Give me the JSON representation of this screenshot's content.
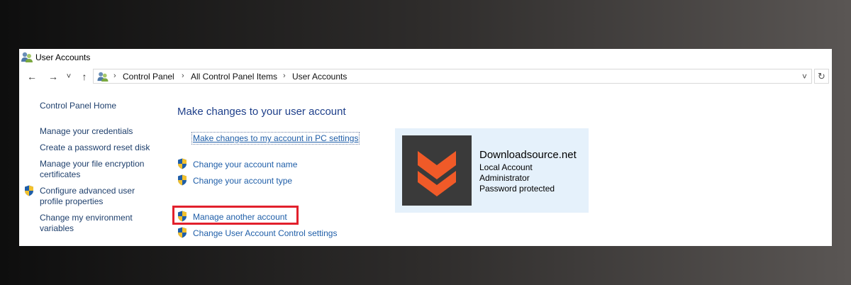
{
  "window": {
    "title": "User Accounts"
  },
  "nav": {
    "back_glyph": "←",
    "forward_glyph": "→",
    "recent_glyph": "˅",
    "up_glyph": "↑",
    "dropdown_glyph": "˅",
    "refresh_glyph": "↻"
  },
  "address": {
    "separator": "›",
    "crumbs": [
      "Control Panel",
      "All Control Panel Items",
      "User Accounts"
    ]
  },
  "sidebar": {
    "home": "Control Panel Home",
    "credentials": "Manage your credentials",
    "reset_disk": "Create a password reset disk",
    "encryption_1": "Manage your file encryption",
    "encryption_2": "certificates",
    "advanced_1": "Configure advanced user",
    "advanced_2": "profile properties",
    "environment_1": "Change my environment",
    "environment_2": "variables"
  },
  "main": {
    "heading": "Make changes to your user account",
    "pc_settings": "Make changes to my account in PC settings",
    "change_name": "Change your account name",
    "change_type": "Change your account type",
    "manage_other": "Manage another account",
    "uac_settings": "Change User Account Control settings"
  },
  "account": {
    "name": "Downloadsource.net",
    "type": "Local Account",
    "role": "Administrator",
    "password_status": "Password protected"
  },
  "colors": {
    "link": "#1f5ea8",
    "heading": "#1e3f8a",
    "card_bg": "#e5f1fb",
    "highlight": "#e2202c",
    "avatar_bg": "#3a3a3a",
    "logo_orange": "#f05a28"
  }
}
